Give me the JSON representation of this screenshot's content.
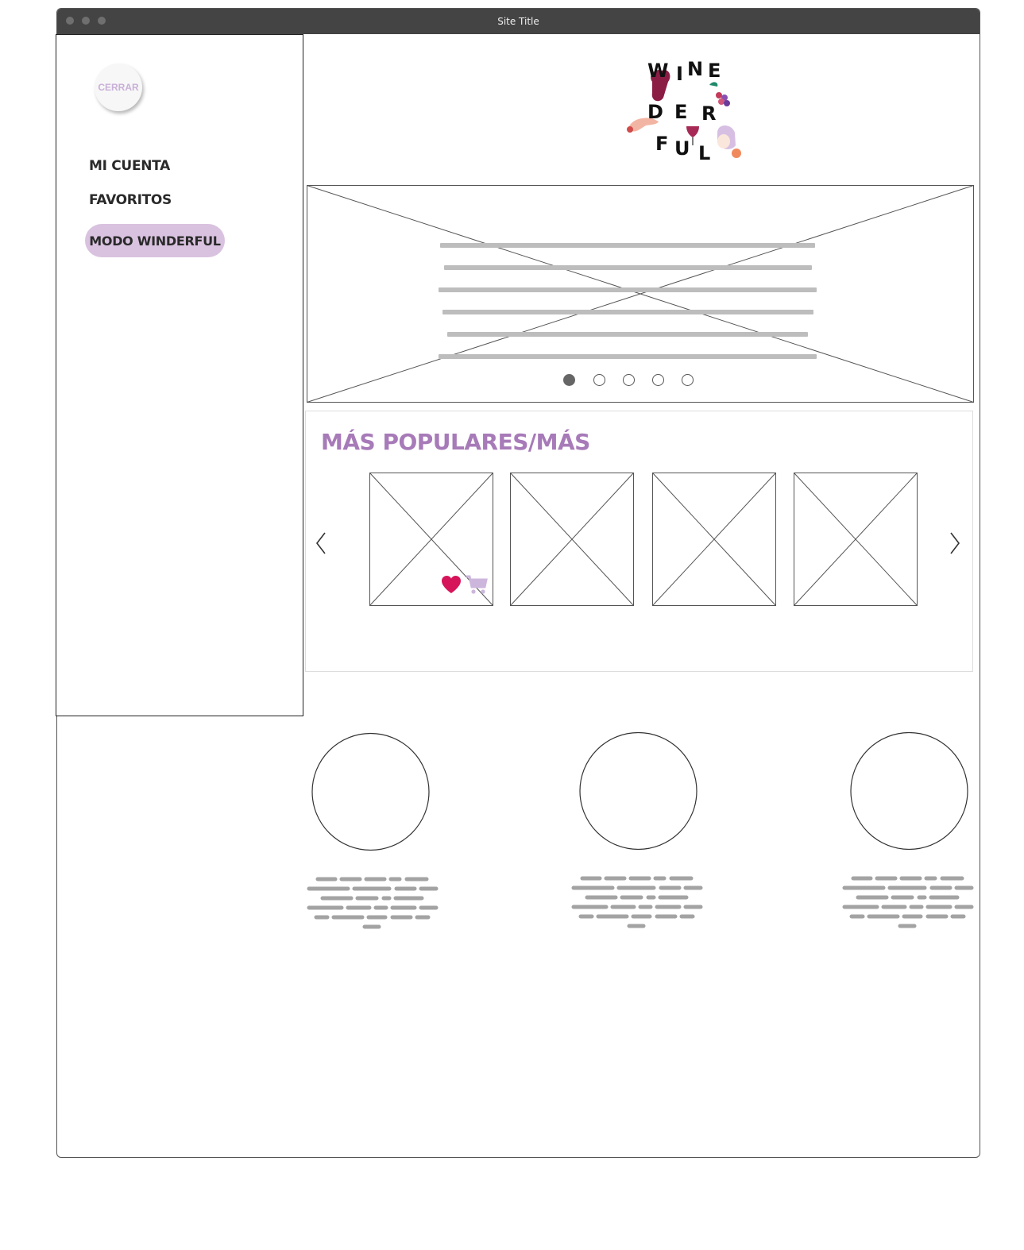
{
  "window": {
    "title": "Site Title"
  },
  "sidebar": {
    "close_label": "CERRAR",
    "items": [
      {
        "label": "MI CUENTA"
      },
      {
        "label": "FAVORITOS"
      }
    ],
    "highlight_item": {
      "label": "MODO WINDERFUL"
    }
  },
  "logo": {
    "letters": [
      "W",
      "I",
      "N",
      "E",
      "D",
      "E",
      "R",
      "F",
      "U",
      "L"
    ]
  },
  "hero": {
    "slides": 5,
    "active_slide": 1
  },
  "popular": {
    "title": "MÁS POPULARES/MÁS",
    "products": 4
  },
  "features": {
    "count": 3
  },
  "colors": {
    "accent": "#a77ab8",
    "pill": "#d9c2df",
    "heart": "#d6145a",
    "cart": "#cdb6dc",
    "titlebar": "#444444",
    "placeholder_text": "#bdbdbd"
  },
  "icons": [
    "heart-icon",
    "cart-icon",
    "chevron-left-icon",
    "chevron-right-icon"
  ]
}
